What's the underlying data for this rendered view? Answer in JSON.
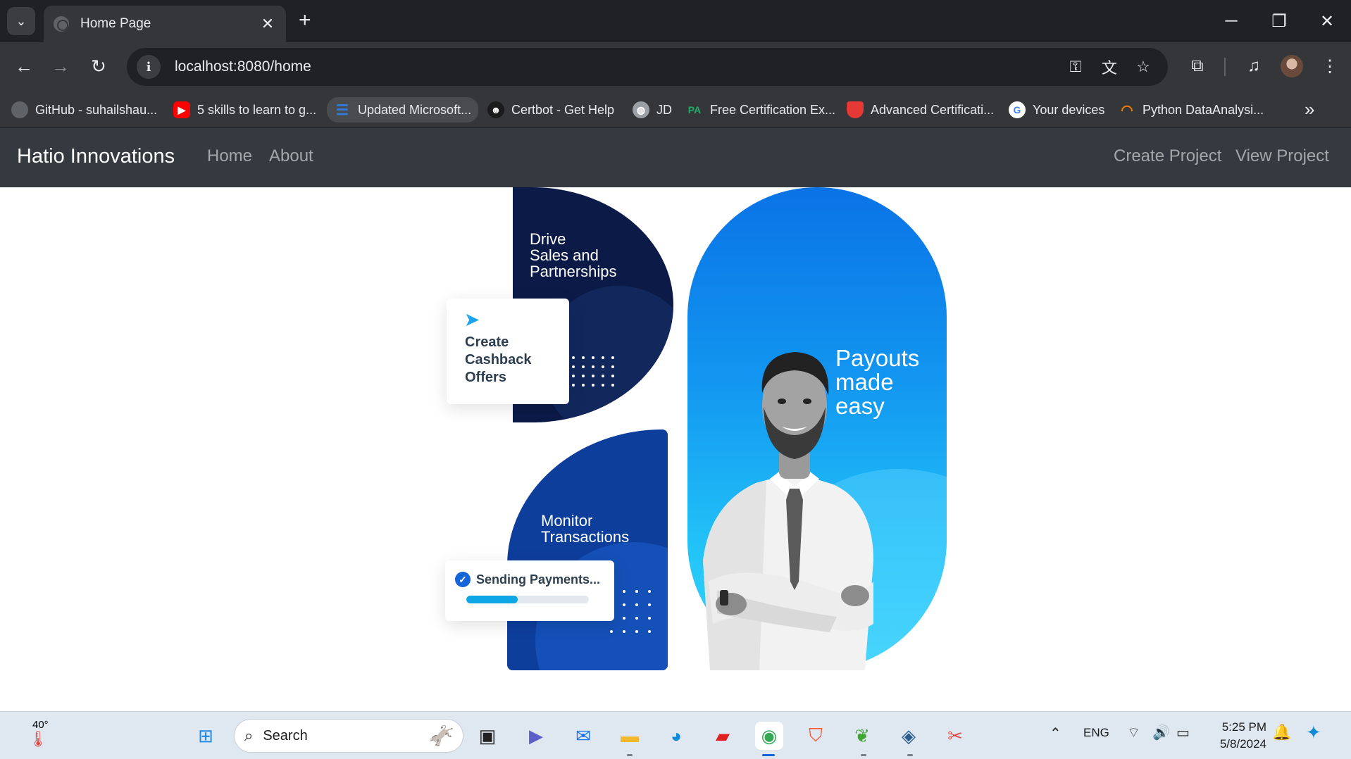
{
  "browser": {
    "tab": {
      "title": "Home Page",
      "close_icon": "close-icon"
    },
    "new_tab_icon": "plus-icon",
    "window_controls": [
      "minimize-icon",
      "restore-icon",
      "close-icon"
    ],
    "url": "localhost:8080/home",
    "bookmarks": [
      {
        "label": "GitHub - suhailshau...",
        "icon": "github-icon",
        "color": "#5f6368"
      },
      {
        "label": "5 skills to learn to g...",
        "icon": "youtube-icon",
        "color": "#ff0000"
      },
      {
        "label": "Updated Microsoft...",
        "icon": "doc-icon",
        "color": "#2f7de1"
      },
      {
        "label": "Certbot - Get Help",
        "icon": "certbot-icon",
        "color": "#1b1b1b"
      },
      {
        "label": "JD",
        "icon": "globe-icon",
        "color": "#9aa0a6"
      },
      {
        "label": "Free Certification Ex...",
        "icon": "pa-icon",
        "color": "#1fae6a"
      },
      {
        "label": "Advanced Certificati...",
        "icon": "shield-icon",
        "color": "#e53935"
      },
      {
        "label": "Your devices",
        "icon": "google-icon",
        "color": "#ffffff"
      },
      {
        "label": "Python DataAnalysi...",
        "icon": "swirl-icon",
        "color": "#f57c00"
      }
    ]
  },
  "app": {
    "brand": "Hatio Innovations",
    "nav_left": [
      "Home",
      "About"
    ],
    "nav_right": [
      "Create Project",
      "View Project"
    ]
  },
  "hero": {
    "drive_text": "Drive\nSales and\nPartnerships",
    "cashback_text": "Create\nCashback\nOffers",
    "monitor_text": "Monitor\nTransactions",
    "sending_label": "Sending Payments...",
    "sending_progress_pct": 42,
    "payouts_text": "Payouts\nmade\neasy",
    "colors": {
      "navy": "#0b1a47",
      "royal": "#0d3e9c",
      "sky": "#1296f0",
      "progress": "#0fa6e6"
    }
  },
  "taskbar": {
    "weather_temp": "40°",
    "search_placeholder": "Search",
    "tray_lang": "ENG",
    "time": "5:25 PM",
    "date": "5/8/2024"
  }
}
